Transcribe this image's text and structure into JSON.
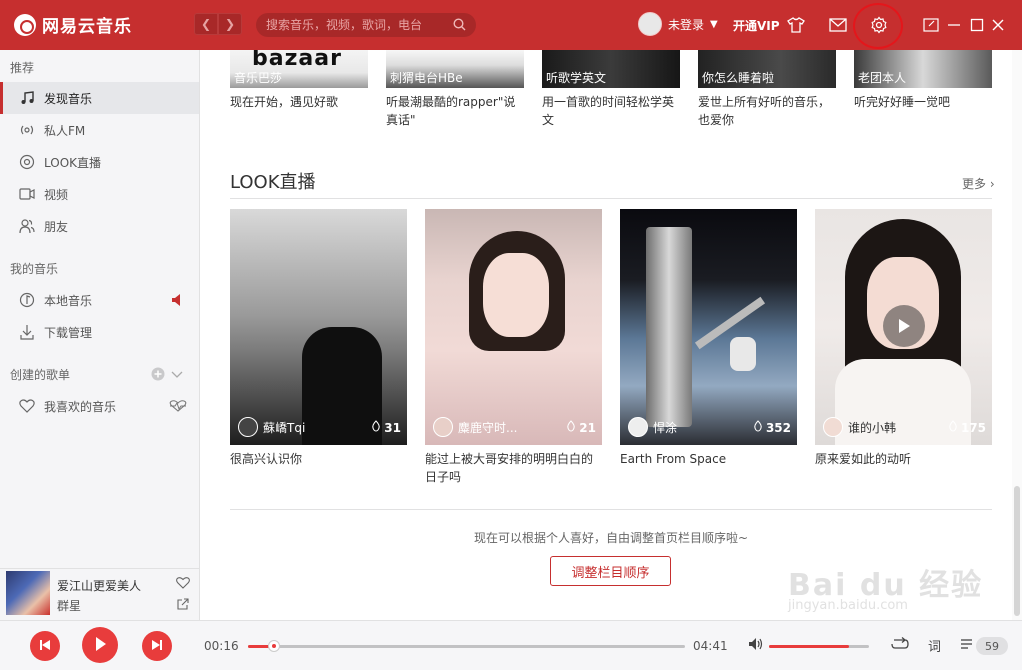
{
  "app": {
    "name": "网易云音乐"
  },
  "header": {
    "search_placeholder": "搜索音乐，视频，歌词，电台",
    "user_label": "未登录",
    "vip_label": "开通VIP"
  },
  "sidebar": {
    "section_recommend": "推荐",
    "recommend_items": [
      {
        "label": "发现音乐",
        "icon": "music-note-icon"
      },
      {
        "label": "私人FM",
        "icon": "radio-icon"
      },
      {
        "label": "LOOK直播",
        "icon": "live-icon"
      },
      {
        "label": "视频",
        "icon": "video-icon"
      },
      {
        "label": "朋友",
        "icon": "friends-icon"
      }
    ],
    "section_my_music": "我的音乐",
    "my_music_items": [
      {
        "label": "本地音乐",
        "icon": "local-music-icon"
      },
      {
        "label": "下载管理",
        "icon": "download-icon"
      }
    ],
    "section_playlists": "创建的歌单",
    "playlist_items": [
      {
        "label": "我喜欢的音乐",
        "icon": "heart-icon"
      }
    ]
  },
  "now_playing": {
    "title": "爱江山更爱美人",
    "artist": "群星",
    "elapsed": "00:16",
    "duration": "04:41",
    "progress": 0.06,
    "volume": 0.8,
    "playlist_count": "59"
  },
  "top_row": [
    {
      "overlay": "音乐巴莎",
      "logo_text": "bazaar",
      "caption": "现在开始，遇见好歌"
    },
    {
      "overlay": "刺猬电台HBe",
      "caption": "听最潮最酷的rapper\"说真话\""
    },
    {
      "overlay": "听歌学英文",
      "caption": "用一首歌的时间轻松学英文"
    },
    {
      "overlay": "你怎么睡着啦",
      "caption": "爱世上所有好听的音乐，也爱你"
    },
    {
      "overlay": "老团本人",
      "caption": "听完好好睡一觉吧"
    }
  ],
  "look_section": {
    "title": "LOOK直播",
    "more_label": "更多",
    "cards": [
      {
        "host": "蘇嶠Tqi",
        "count": "31",
        "caption": "很高兴认识你"
      },
      {
        "host": "麋鹿守时...",
        "count": "21",
        "caption": "能过上被大哥安排的明明白白的日子吗"
      },
      {
        "host": "悍涂",
        "count": "352",
        "caption": "Earth From Space"
      },
      {
        "host": "谁的小韩",
        "count": "175",
        "caption": "原来爱如此的动听"
      }
    ]
  },
  "footer": {
    "hint": "现在可以根据个人喜好，自由调整首页栏目顺序啦~",
    "adjust_button": "调整栏目顺序"
  },
  "playerbar": {
    "lyrics_label": "词"
  },
  "watermark": {
    "big": "Bai du 经验",
    "small": "jingyan.baidu.com"
  },
  "colors": {
    "brand_red": "#c62f2f",
    "accent_red": "#e83c3c"
  }
}
